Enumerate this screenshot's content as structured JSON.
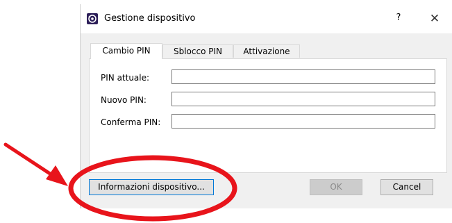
{
  "dialog": {
    "title": "Gestione dispositivo",
    "app_icon": "smartcard-icon",
    "help_label": "?",
    "close_label": "✕"
  },
  "tabs": [
    {
      "label": "Cambio PIN",
      "active": true
    },
    {
      "label": "Sblocco PIN",
      "active": false
    },
    {
      "label": "Attivazione",
      "active": false
    }
  ],
  "form": {
    "current_pin": {
      "label": "PIN attuale:",
      "value": ""
    },
    "new_pin": {
      "label": "Nuovo PIN:",
      "value": ""
    },
    "confirm_pin": {
      "label": "Conferma PIN:",
      "value": ""
    }
  },
  "buttons": {
    "device_info": "Informazioni dispositivo...",
    "ok": "OK",
    "ok_enabled": false,
    "cancel": "Cancel"
  },
  "annotation": {
    "color": "#e8141b"
  }
}
